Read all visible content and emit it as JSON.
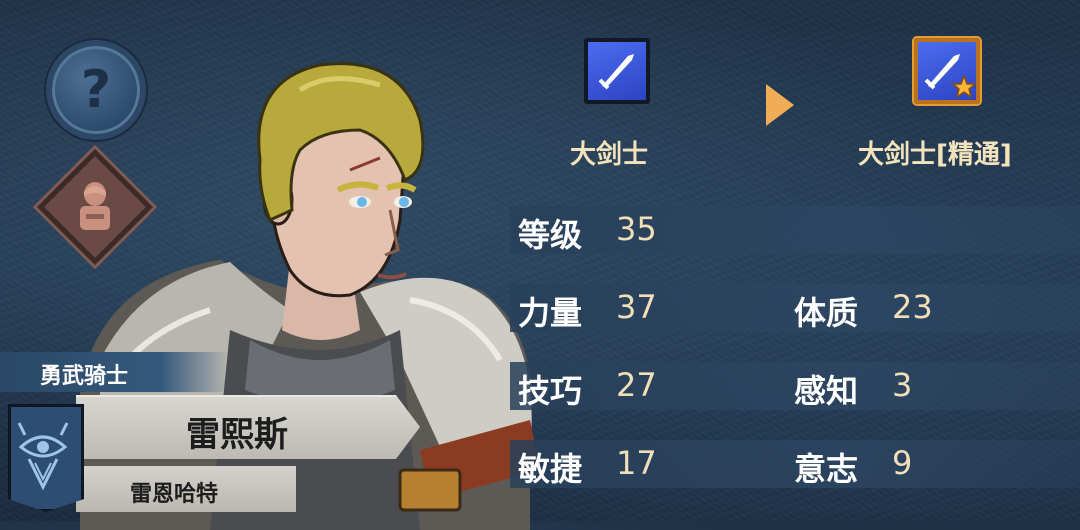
{
  "left_buttons": {
    "help_icon": "question-mark-icon",
    "help_glyph": "?",
    "portrait_icon": "hooded-figure-icon"
  },
  "character": {
    "title": "勇武骑士",
    "name": "雷熙斯",
    "origin": "雷恩哈特",
    "banner_icon": "eye-crest-icon"
  },
  "classes": {
    "current": {
      "label": "大剑士",
      "icon": "sword-icon"
    },
    "advance_icon": "arrow-right-icon",
    "next": {
      "label": "大剑士[精通]",
      "icon": "sword-star-icon"
    }
  },
  "stats": {
    "level": {
      "label": "等级",
      "value": "35"
    },
    "strength": {
      "label": "力量",
      "value": "37"
    },
    "constitution": {
      "label": "体质",
      "value": "23"
    },
    "skill": {
      "label": "技巧",
      "value": "27"
    },
    "perception": {
      "label": "感知",
      "value": "3"
    },
    "agility": {
      "label": "敏捷",
      "value": "17"
    },
    "will": {
      "label": "意志",
      "value": "9"
    }
  },
  "colors": {
    "accent_gold": "#f1ad56",
    "label_cream": "#f3e3bc",
    "class_blue": "#3b5be0",
    "mastery_border": "#e79c32"
  }
}
